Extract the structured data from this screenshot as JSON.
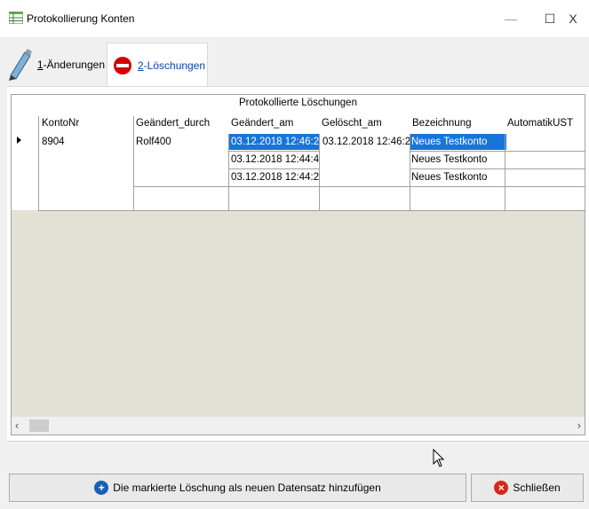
{
  "window": {
    "title": "Protokollierung Konten",
    "minimize": "—",
    "maximize": "☐",
    "close": "X"
  },
  "tabs": [
    {
      "hotkey": "1",
      "label": "-Änderungen",
      "icon": "pencil-icon"
    },
    {
      "hotkey": "2",
      "label": "-Löschungen",
      "icon": "no-entry-icon",
      "active": true
    }
  ],
  "grid": {
    "caption": "Protokollierte Löschungen",
    "columns": [
      "KontoNr",
      "Geändert_durch",
      "Geändert_am",
      "Gelöscht_am",
      "Bezeichnung",
      "AutomatikUST"
    ],
    "row": {
      "konto_nr": "8904",
      "geaendert_durch": "Rolf400",
      "geloescht_am": "03.12.2018 12:46:2",
      "sub_rows": [
        {
          "geaendert_am": "03.12.2018 12:46:2",
          "bezeichnung": "Neues Testkonto",
          "selected": true
        },
        {
          "geaendert_am": "03.12.2018 12:44:4",
          "bezeichnung": "Neues Testkonto"
        },
        {
          "geaendert_am": "03.12.2018 12:44:2",
          "bezeichnung": "Neues Testkonto"
        }
      ]
    }
  },
  "scroll": {
    "left_arrow": "‹",
    "right_arrow": "›"
  },
  "buttons": {
    "add_label": "Die markierte Löschung als neuen Datensatz hinzufügen",
    "close_label": "Schließen"
  },
  "colors": {
    "selection": "#1874d8",
    "grid_background": "#e3e0d6"
  }
}
